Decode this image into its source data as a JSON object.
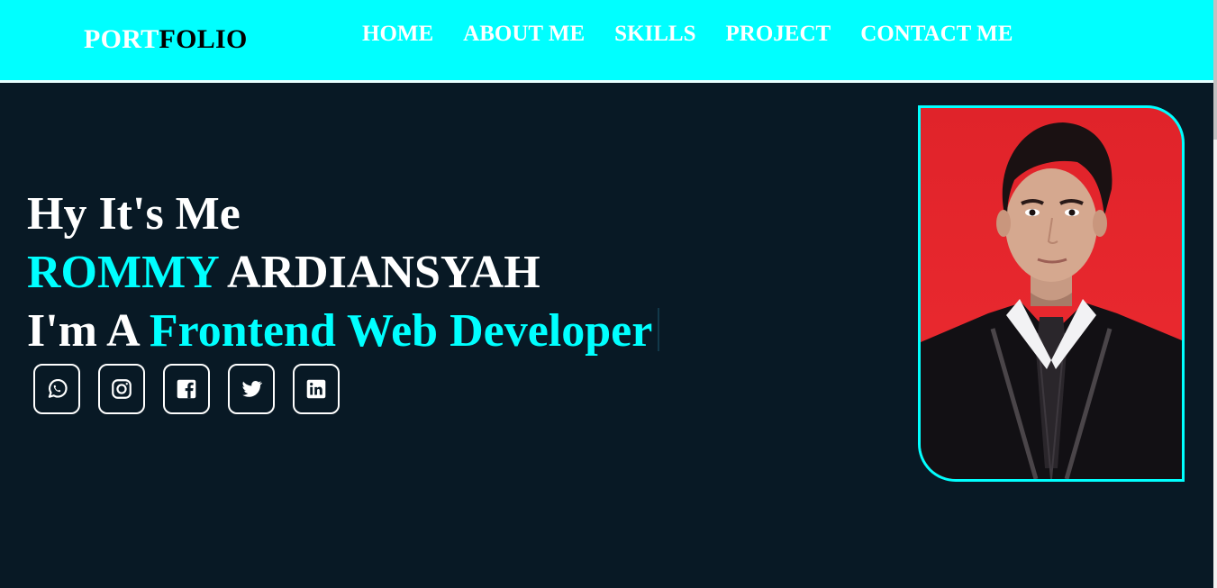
{
  "logo": {
    "part1": "PORT",
    "part2": "FOLIO"
  },
  "nav": [
    "HOME",
    "ABOUT ME",
    "SKILLS",
    "PROJECT",
    "CONTACT ME"
  ],
  "hero": {
    "greeting": "Hy It's Me",
    "first_name": "ROMMY",
    "last_name": "ARDIANSYAH",
    "role_prefix": "I'm A",
    "role": "Frontend Web Developer"
  },
  "socials": [
    "whatsapp-icon",
    "instagram-icon",
    "facebook-icon",
    "twitter-icon",
    "linkedin-icon"
  ],
  "colors": {
    "accent": "#00ffff",
    "background": "#081925",
    "text": "#ffffff",
    "photo_bg": "#e3252b"
  }
}
